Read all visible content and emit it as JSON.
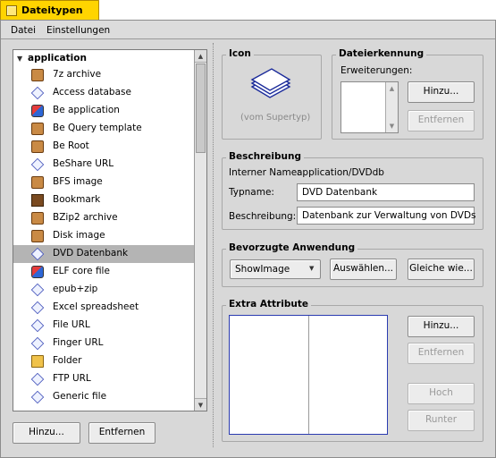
{
  "window": {
    "title": "Dateitypen"
  },
  "menu": [
    "Datei",
    "Einstellungen"
  ],
  "list": {
    "root": "application",
    "items": [
      {
        "label": "7z archive",
        "icon": "archive-icon"
      },
      {
        "label": "Access database",
        "icon": "document-icon"
      },
      {
        "label": "Be application",
        "icon": "app-icon"
      },
      {
        "label": "Be Query template",
        "icon": "query-icon"
      },
      {
        "label": "Be Root",
        "icon": "root-icon"
      },
      {
        "label": "BeShare URL",
        "icon": "document-icon"
      },
      {
        "label": "BFS image",
        "icon": "archive-icon"
      },
      {
        "label": "Bookmark",
        "icon": "bookmark-icon"
      },
      {
        "label": "BZip2 archive",
        "icon": "archive-icon"
      },
      {
        "label": "Disk image",
        "icon": "archive-icon"
      },
      {
        "label": "DVD Datenbank",
        "icon": "document-icon",
        "selected": true
      },
      {
        "label": "ELF core file",
        "icon": "app-icon"
      },
      {
        "label": "epub+zip",
        "icon": "document-icon"
      },
      {
        "label": "Excel spreadsheet",
        "icon": "document-icon"
      },
      {
        "label": "File URL",
        "icon": "document-icon"
      },
      {
        "label": "Finger URL",
        "icon": "document-icon"
      },
      {
        "label": "Folder",
        "icon": "folder-icon"
      },
      {
        "label": "FTP URL",
        "icon": "document-icon"
      },
      {
        "label": "Generic file",
        "icon": "document-icon"
      }
    ]
  },
  "left_buttons": {
    "add": "Hinzu...",
    "remove": "Entfernen"
  },
  "icon_group": {
    "title": "Icon",
    "caption": "(vom Supertyp)"
  },
  "recognition": {
    "title": "Dateierkennung",
    "extensions_label": "Erweiterungen:",
    "add": "Hinzu...",
    "remove": "Entfernen"
  },
  "description": {
    "title": "Beschreibung",
    "internal_label": "Interner Name:",
    "internal_value": "application/DVDdb",
    "type_label": "Typname:",
    "type_value": "DVD Datenbank",
    "desc_label": "Beschreibung:",
    "desc_value": "Datenbank zur Verwaltung von DVDs"
  },
  "preferred": {
    "title": "Bevorzugte Anwendung",
    "app_value": "ShowImage",
    "choose": "Auswählen...",
    "same_as": "Gleiche wie..."
  },
  "extra": {
    "title": "Extra Attribute",
    "add": "Hinzu...",
    "remove": "Entfernen",
    "up": "Hoch",
    "down": "Runter"
  },
  "colors": {
    "title_tab": "#ffd400",
    "selection": "#b4b4b4",
    "window_bg": "#d8d8d8"
  }
}
